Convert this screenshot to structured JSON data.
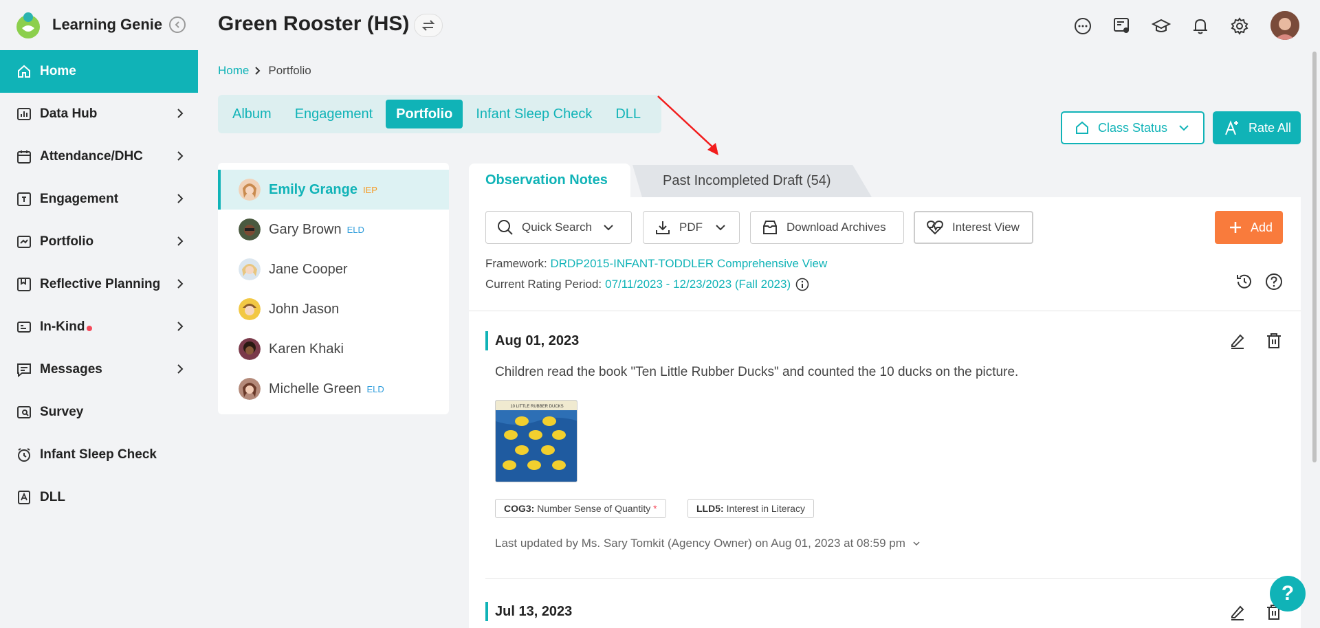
{
  "app": {
    "name": "Learning Genie",
    "accent": "#10b3b7"
  },
  "sidebar": {
    "items": [
      {
        "label": "Home",
        "icon": "home-icon",
        "active": true
      },
      {
        "label": "Data Hub",
        "icon": "chart-icon"
      },
      {
        "label": "Attendance/DHC",
        "icon": "calendar-icon"
      },
      {
        "label": "Engagement",
        "icon": "engagement-icon"
      },
      {
        "label": "Portfolio",
        "icon": "portfolio-icon"
      },
      {
        "label": "Reflective Planning",
        "icon": "planning-icon"
      },
      {
        "label": "In-Kind",
        "icon": "inkind-icon",
        "has_dot": true
      },
      {
        "label": "Messages",
        "icon": "message-icon"
      },
      {
        "label": "Survey",
        "icon": "survey-icon"
      },
      {
        "label": "Infant Sleep Check",
        "icon": "alarm-icon"
      },
      {
        "label": "DLL",
        "icon": "dll-icon"
      }
    ]
  },
  "header": {
    "class_name": "Green Rooster (HS)",
    "icons": [
      "chat-icon",
      "report-icon",
      "graduation-cap-icon",
      "bell-icon",
      "gear-icon",
      "avatar"
    ]
  },
  "breadcrumb": {
    "home": "Home",
    "current": "Portfolio"
  },
  "tabs": [
    {
      "label": "Album"
    },
    {
      "label": "Engagement"
    },
    {
      "label": "Portfolio",
      "active": true
    },
    {
      "label": "Infant Sleep Check"
    },
    {
      "label": "DLL"
    }
  ],
  "actions": {
    "class_status": "Class Status",
    "rate_all": "Rate All"
  },
  "children": [
    {
      "name": "Emily Grange",
      "badge": "IEP",
      "active": true
    },
    {
      "name": "Gary Brown",
      "badge": "ELD"
    },
    {
      "name": "Jane Cooper",
      "badge": ""
    },
    {
      "name": "John Jason",
      "badge": ""
    },
    {
      "name": "Karen Khaki",
      "badge": ""
    },
    {
      "name": "Michelle Green",
      "badge": "ELD"
    }
  ],
  "panel_tabs": {
    "observation": "Observation Notes",
    "draft": "Past Incompleted Draft (54)"
  },
  "toolbar": {
    "quick_search": "Quick Search",
    "pdf": "PDF",
    "download_archives": "Download Archives",
    "interest_view": "Interest View",
    "add": "Add"
  },
  "framework": {
    "label": "Framework:",
    "value": "DRDP2015-INFANT-TODDLER Comprehensive View",
    "period_label": "Current Rating Period:",
    "period_value": "07/11/2023 - 12/23/2023 (Fall 2023)"
  },
  "notes": [
    {
      "date": "Aug 01, 2023",
      "text": "Children read the book \"Ten Little Rubber Ducks\" and counted the 10 ducks on the picture.",
      "image_caption": "10 LITTLE RUBBER DUCKS",
      "tags": [
        {
          "code": "COG3:",
          "name": "Number Sense of Quantity",
          "required": "*"
        },
        {
          "code": "LLD5:",
          "name": "Interest in Literacy",
          "required": ""
        }
      ],
      "updated": "Last updated by Ms. Sary Tomkit (Agency Owner) on Aug 01, 2023 at 08:59 pm"
    },
    {
      "date": "Jul 13, 2023"
    }
  ],
  "help_label": "?"
}
